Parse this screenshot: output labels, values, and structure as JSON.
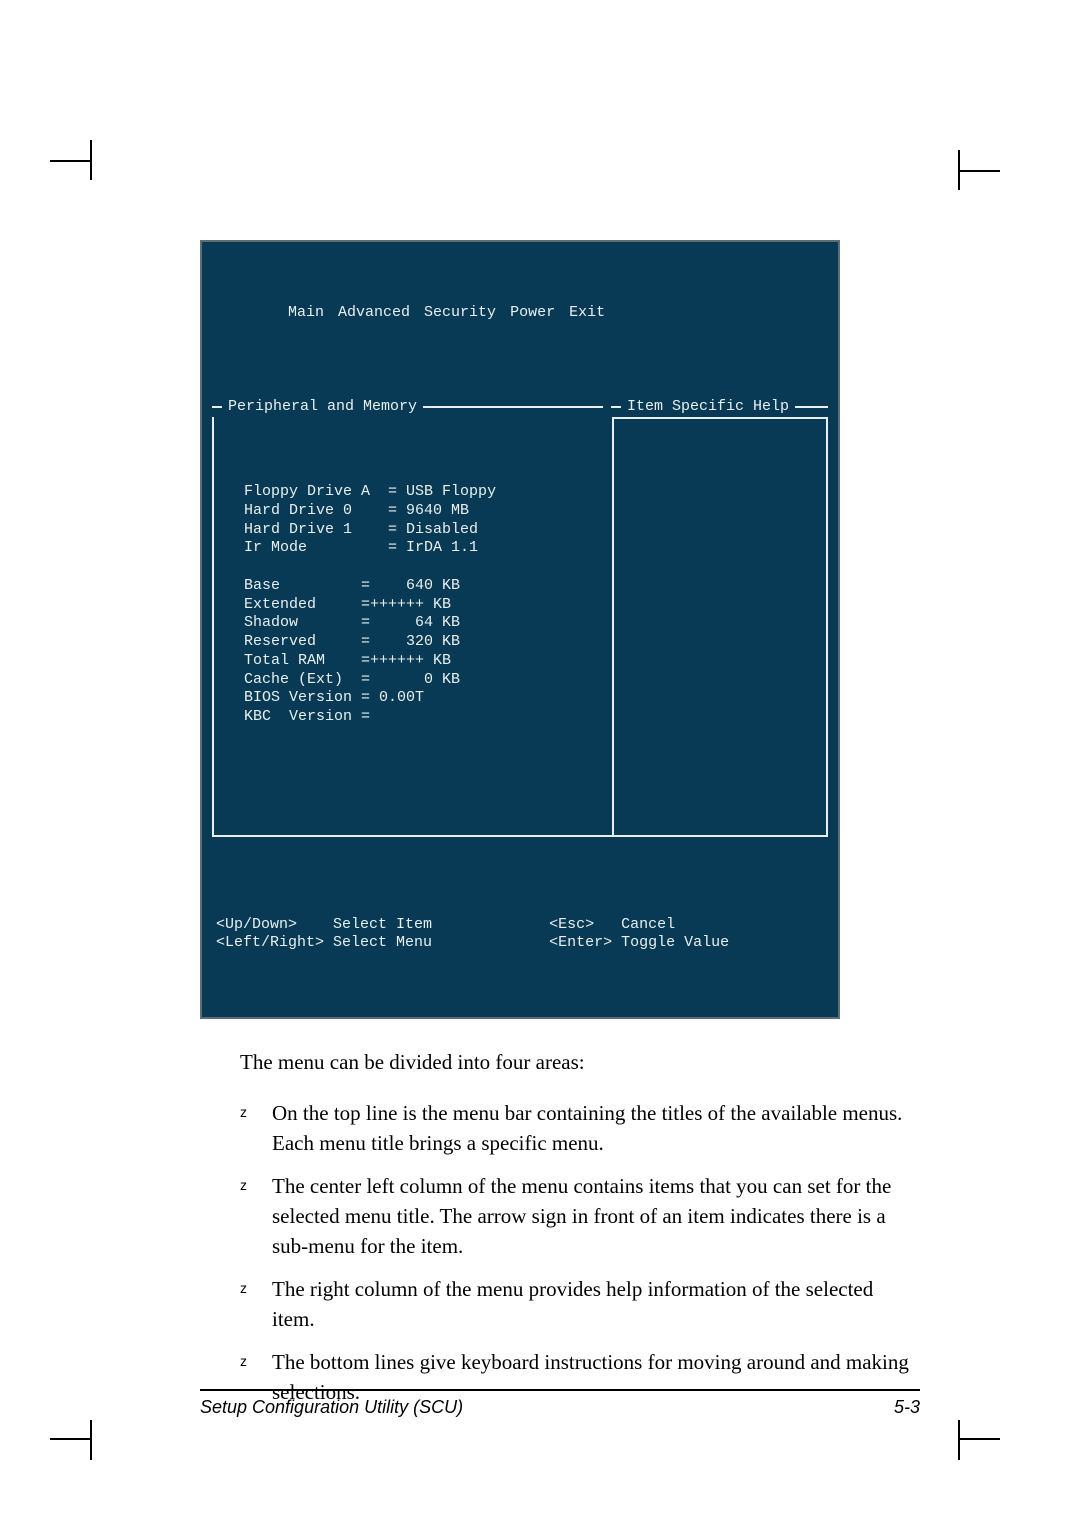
{
  "bios": {
    "menus": [
      "Main",
      "Advanced",
      "Security",
      "Power",
      "Exit"
    ],
    "left_panel_title": "Peripheral and Memory",
    "right_panel_title": "Item Specific Help",
    "settings": [
      {
        "label": "Floppy Drive A",
        "eq": "= USB Floppy"
      },
      {
        "label": "Hard Drive 0",
        "eq": "= 9640 MB"
      },
      {
        "label": "Hard Drive 1",
        "eq": "= Disabled"
      },
      {
        "label": "Ir Mode",
        "eq": "= IrDA 1.1"
      }
    ],
    "memory": [
      {
        "label": "Base",
        "eq": "=    640 KB"
      },
      {
        "label": "Extended",
        "eq": "=++++++ KB"
      },
      {
        "label": "Shadow",
        "eq": "=     64 KB"
      },
      {
        "label": "Reserved",
        "eq": "=    320 KB"
      },
      {
        "label": "Total RAM",
        "eq": "=++++++ KB"
      },
      {
        "label": "Cache (Ext)",
        "eq": "=      0 KB"
      },
      {
        "label": "BIOS Version",
        "eq": "= 0.00T"
      },
      {
        "label": "KBC  Version",
        "eq": "="
      }
    ],
    "footer": {
      "updown_key": "<Up/Down>",
      "updown_label": "Select Item",
      "leftright_key": "<Left/Right>",
      "leftright_label": "Select Menu",
      "esc_key": "<Esc>",
      "esc_label": "Cancel",
      "enter_key": "<Enter>",
      "enter_label": "Toggle Value"
    }
  },
  "explain": {
    "lead": "The menu can be divided into four areas:",
    "items": [
      "On the top line is the menu bar containing the titles of the available menus. Each menu title brings a specific menu.",
      "The center left column of the menu contains items that you can set for the selected menu title. The arrow sign in front of an item indicates there is a sub-menu for the item.",
      "The right column of the menu provides help information of the selected item.",
      "The bottom lines give keyboard instructions for moving around and making selections."
    ]
  },
  "page_footer": {
    "title": "Setup Configuration Utility (SCU)",
    "page_number": "5-3"
  }
}
